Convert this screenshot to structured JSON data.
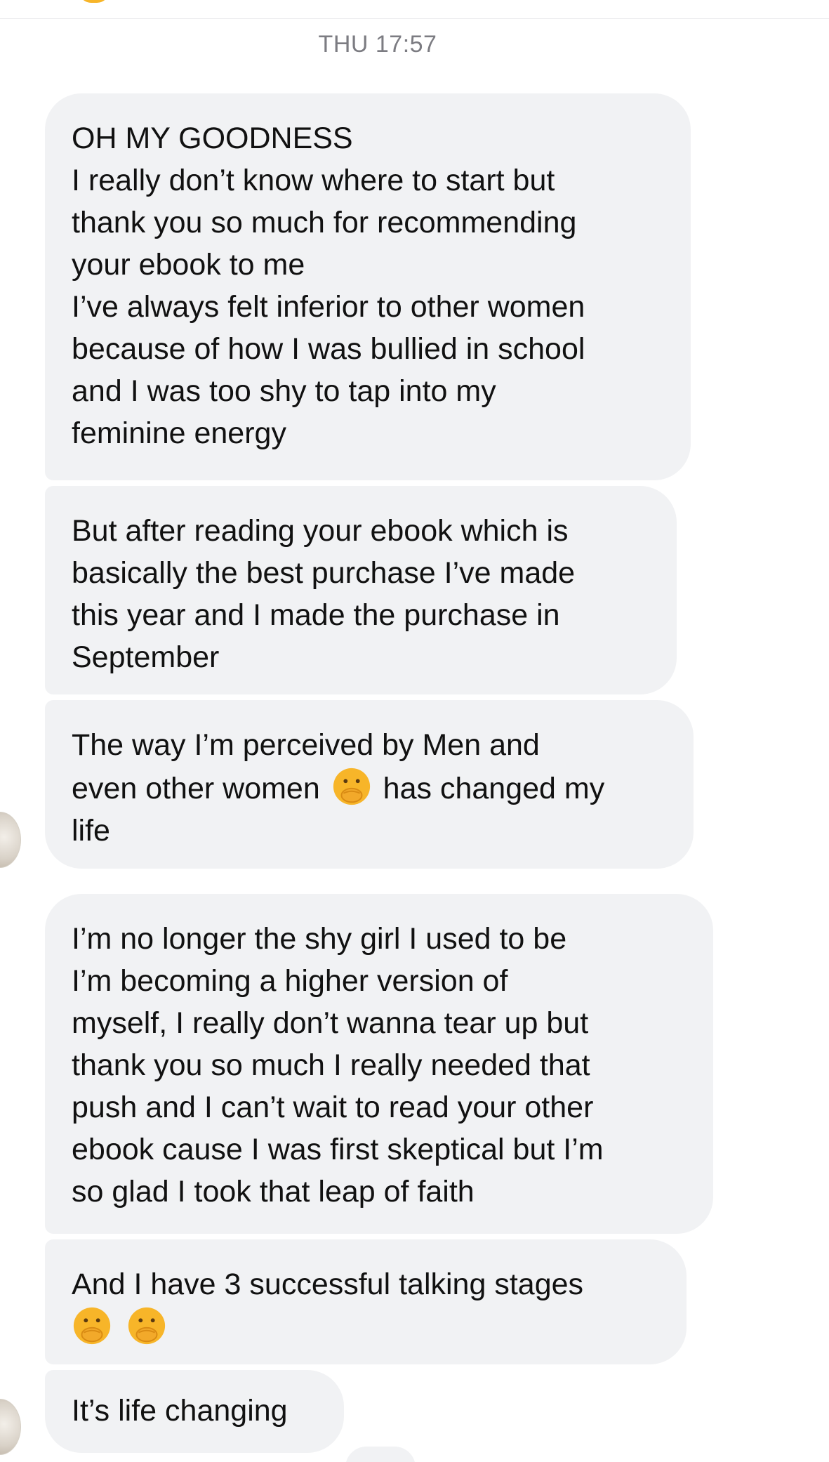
{
  "thread": {
    "timestamp": "THU 17:57",
    "messages": [
      {
        "paragraphs": [
          [
            "OH MY GOODNESS"
          ],
          [
            "I really don’t know where to start but",
            "thank you so much for recommending",
            "your ebook to me"
          ],
          [
            "I’ve always felt inferior to other women",
            "because of how I was bullied in school",
            "and I was too shy to tap into my",
            "feminine energy"
          ]
        ]
      },
      {
        "paragraphs": [
          [
            "But after reading your ebook which is",
            "basically the best purchase I’ve made",
            "this year and I made the purchase in",
            "September"
          ]
        ]
      },
      {
        "line1": "The way I’m perceived by Men and",
        "line2_before": "even other women",
        "line2_after": "has changed my",
        "line3": "life",
        "emoji": "hand-over-mouth-emoji"
      },
      {
        "paragraphs": [
          [
            "I’m no longer the shy girl I used to be"
          ],
          [
            "I’m becoming a higher version of",
            "myself, I really don’t wanna tear up but",
            "thank you so much I really needed that",
            "push and I can’t wait to read your other",
            "ebook cause I was first skeptical but I’m",
            "so glad I took that leap of faith"
          ]
        ]
      },
      {
        "line1": "And I have 3 successful talking stages",
        "emojis": [
          "hand-over-mouth-emoji",
          "hand-over-mouth-emoji"
        ]
      },
      {
        "text": "It’s life changing"
      }
    ]
  },
  "colors": {
    "bubble_bg": "#f1f2f4",
    "text": "#111111",
    "timestamp": "#7c7c82",
    "emoji_face": "#f7b529"
  }
}
